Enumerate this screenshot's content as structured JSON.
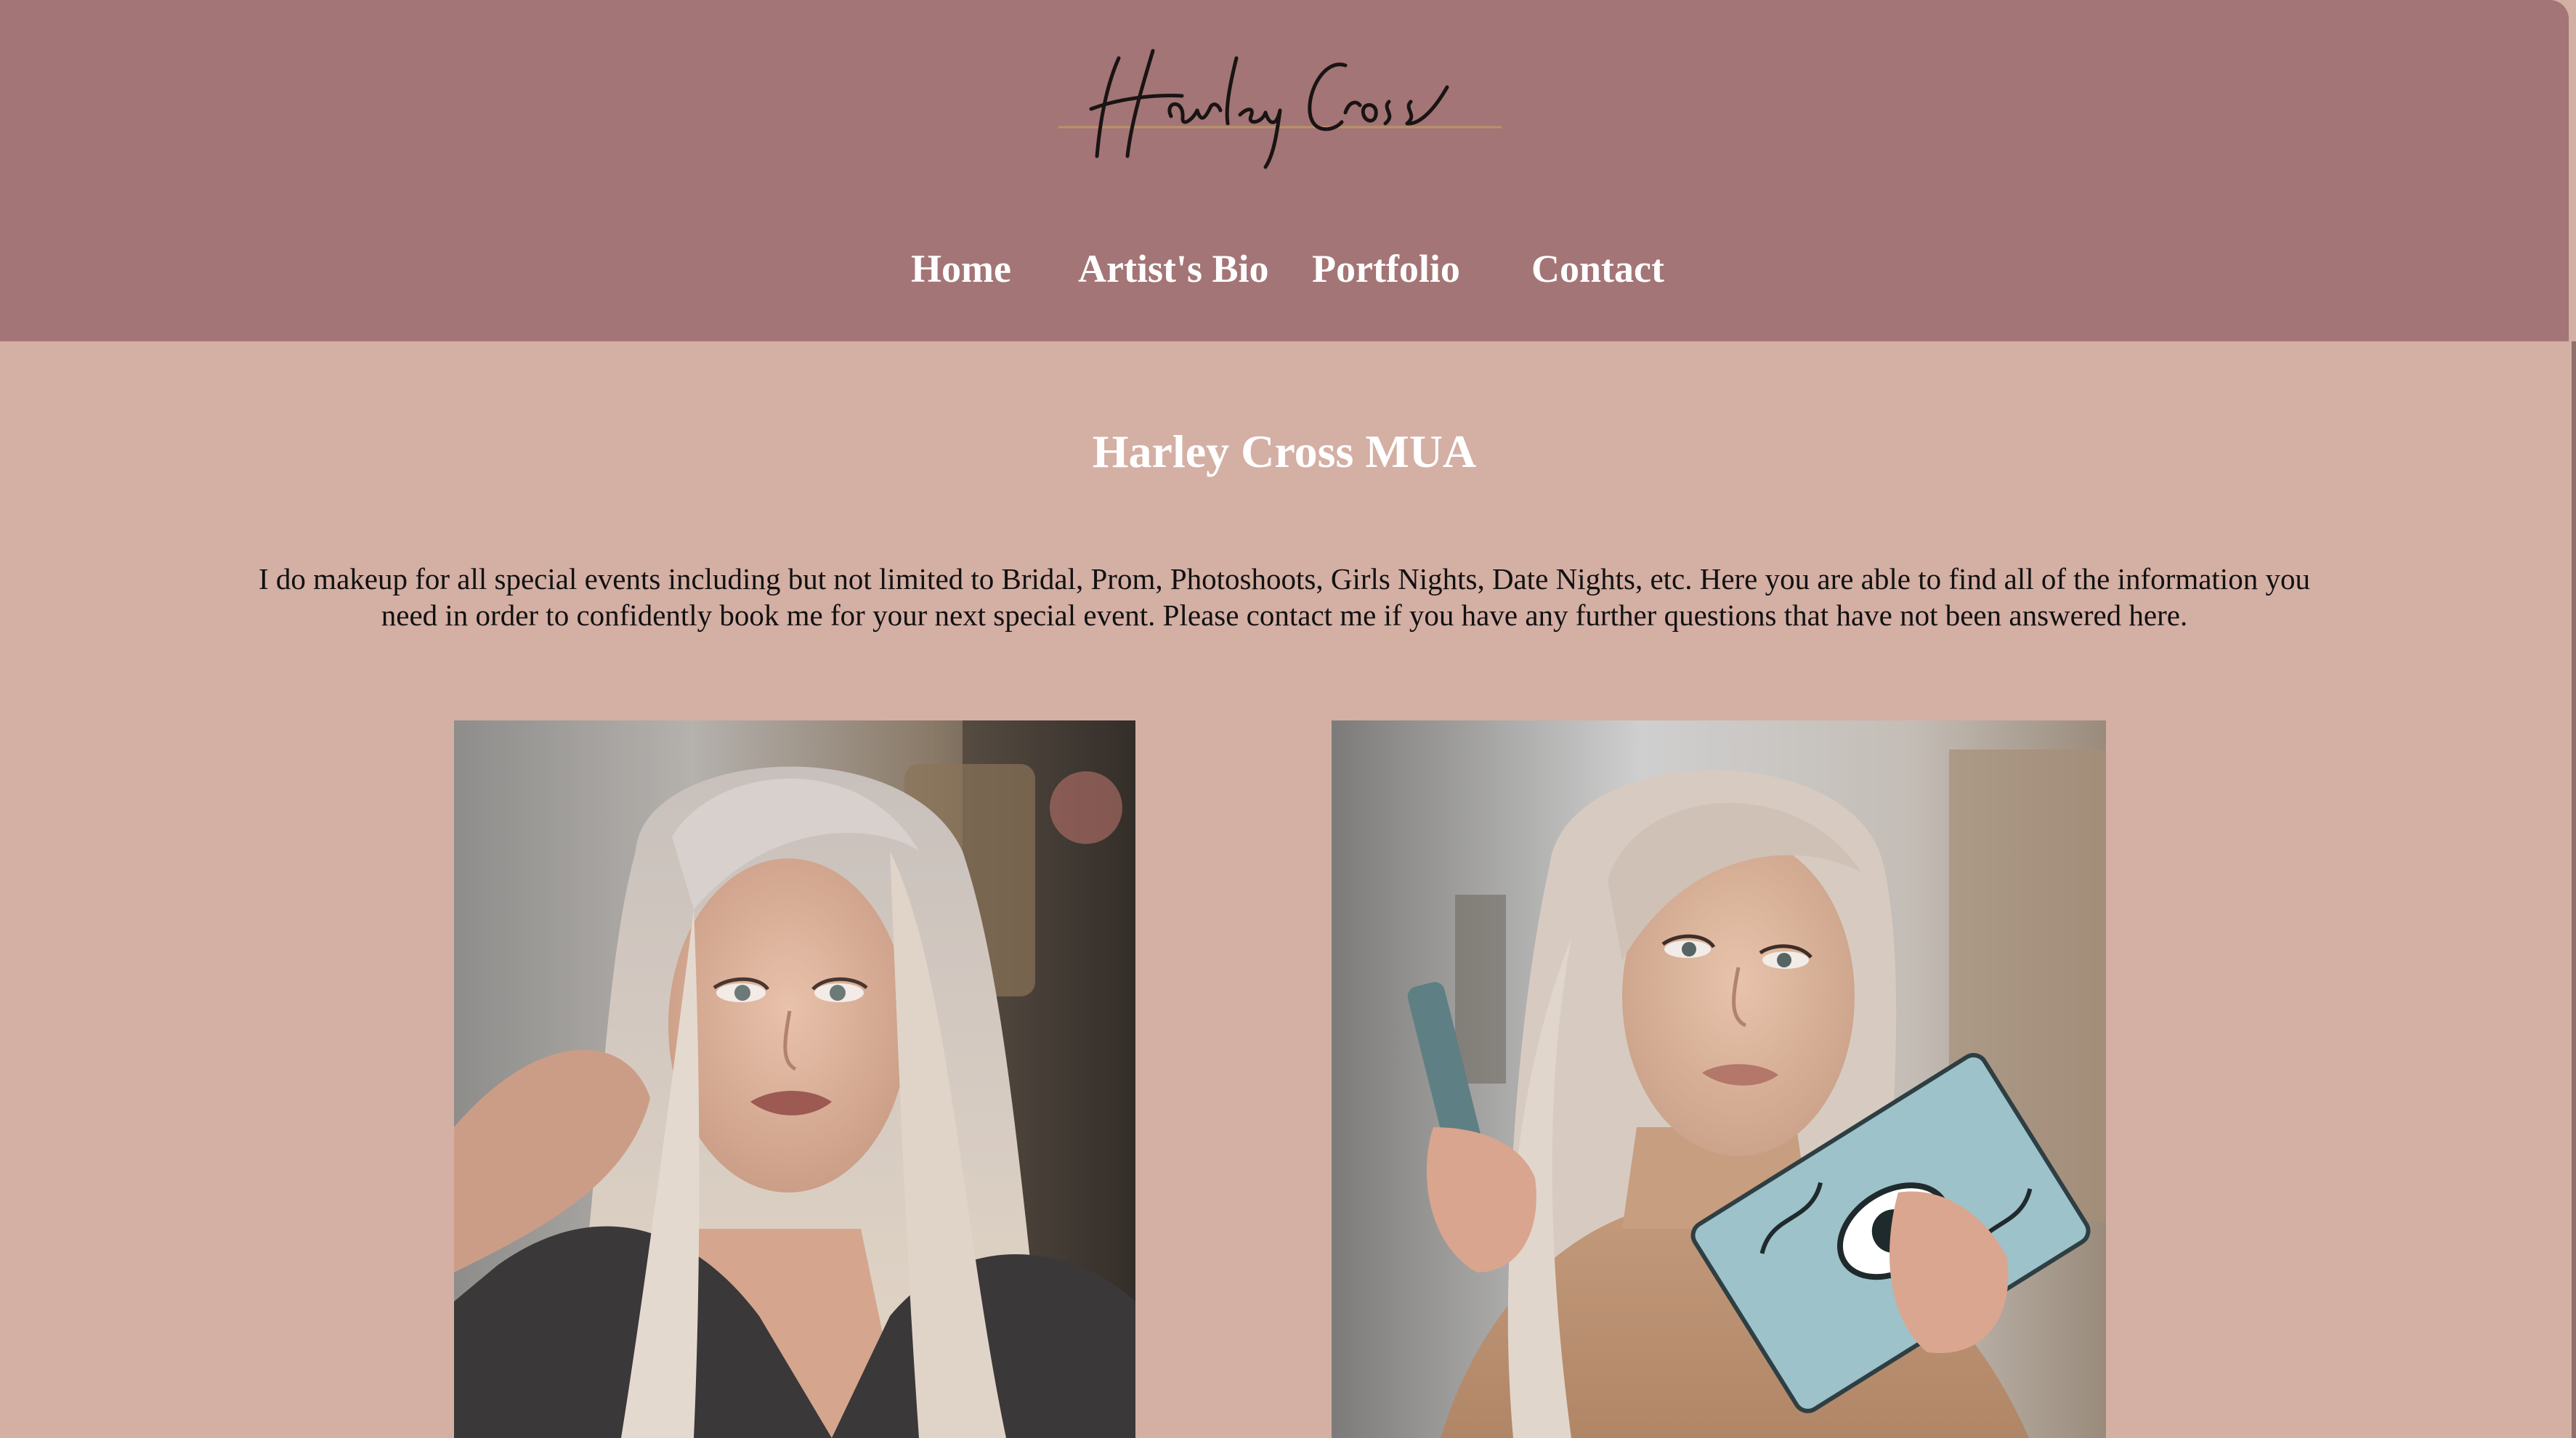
{
  "header": {
    "logo_text": "Harley Cross",
    "nav": {
      "home": "Home",
      "bio": "Artist's Bio",
      "portfolio": "Portfolio",
      "contact": "Contact"
    }
  },
  "main": {
    "title": "Harley Cross MUA",
    "intro": "I do makeup for all special events including but not limited to Bridal, Prom, Photoshoots, Girls Nights, Date Nights, etc. Here you are able to find all of the information you need in order to confidently book me for your next special event. Please contact me if you have any further questions that have not been answered here."
  },
  "colors": {
    "header_bg": "#a47576",
    "page_bg": "#d4afa4",
    "logo_line": "#b8946a"
  }
}
